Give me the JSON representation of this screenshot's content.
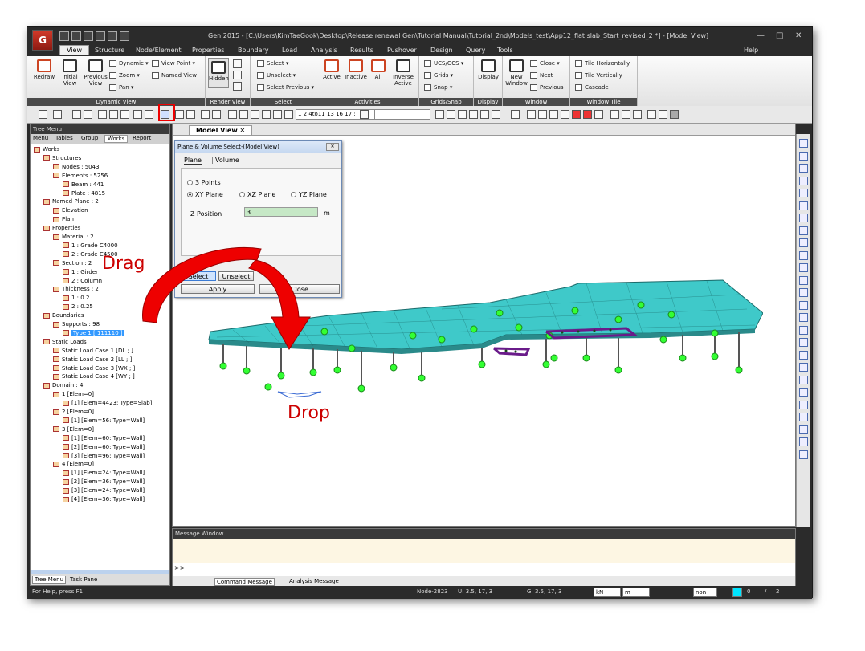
{
  "window": {
    "title": "Gen 2015 - [C:\\Users\\KimTaeGook\\Desktop\\Release renewal Gen\\Tutorial Manual\\Tutorial_2nd\\Models_test\\App12_flat slab_Start_revised_2 *] - [Model View]",
    "logo": "G",
    "help": "Help"
  },
  "menu": {
    "tabs": [
      "View",
      "Structure",
      "Node/Element",
      "Properties",
      "Boundary",
      "Load",
      "Analysis",
      "Results",
      "Pushover",
      "Design",
      "Query",
      "Tools"
    ]
  },
  "ribbon": {
    "dynamic_view": {
      "label": "Dynamic View",
      "redraw": "Redraw",
      "initial": "Initial View",
      "previous": "Previous View",
      "dynamic": "Dynamic",
      "zoom": "Zoom",
      "pan": "Pan",
      "view_point": "View Point",
      "named_view": "Named View"
    },
    "render_view": {
      "label": "Render View",
      "hidden": "Hidden"
    },
    "select": {
      "label": "Select",
      "select": "Select",
      "unselect": "Unselect",
      "select_previous": "Select Previous"
    },
    "activities": {
      "label": "Activities",
      "active": "Active",
      "inactive": "Inactive",
      "all": "All",
      "inverse_active": "Inverse Active"
    },
    "grids_snap": {
      "label": "Grids/Snap",
      "ucs": "UCS/GCS",
      "grids": "Grids",
      "snap": "Snap"
    },
    "display": {
      "label": "Display",
      "display": "Display"
    },
    "window": {
      "label": "Window",
      "new_window": "New Window",
      "close": "Close",
      "next": "Next",
      "previous": "Previous"
    },
    "window_tile": {
      "label": "Window Tile",
      "horizontal": "Tile Horizontally",
      "vertical": "Tile Vertically",
      "cascade": "Cascade"
    }
  },
  "toolbar": {
    "combo": "1 2 4to11 13 16 17 :"
  },
  "tree": {
    "header": "Tree Menu",
    "tabs": [
      "Menu",
      "Tables",
      "Group",
      "Works",
      "Report"
    ],
    "nodes": [
      "Works",
      "Structures",
      "Nodes : 5043",
      "Elements : 5256",
      "Beam : 441",
      "Plate : 4815",
      "Named Plane : 2",
      "Elevation",
      "Plan",
      "Properties",
      "Material : 2",
      "1 : Grade C4000",
      "2 : Grade C4500",
      "Section : 2",
      "1 : Girder",
      "2 : Column",
      "Thickness : 2",
      "1 : 0.2",
      "2 : 0.25",
      "Boundaries",
      "Supports : 98",
      "Type 1 [ 111110 ]",
      "Static Loads",
      "Static Load Case 1 [DL ; ]",
      "Static Load Case 2 [LL ; ]",
      "Static Load Case 3 [WX ; ]",
      "Static Load Case 4 [WY ; ]",
      "Domain : 4",
      "1 [Elem=0]",
      "[1] [Elem=4423: Type=Slab]",
      "2 [Elem=0]",
      "[1] [Elem=56: Type=Wall]",
      "3 [Elem=0]",
      "[1] [Elem=60: Type=Wall]",
      "[2] [Elem=60: Type=Wall]",
      "[3] [Elem=96: Type=Wall]",
      "4 [Elem=0]",
      "[1] [Elem=24: Type=Wall]",
      "[2] [Elem=36: Type=Wall]",
      "[3] [Elem=24: Type=Wall]",
      "[4] [Elem=36: Type=Wall]"
    ],
    "bottom_tabs": [
      "Tree Menu",
      "Task Pane"
    ]
  },
  "view": {
    "tab": "Model View"
  },
  "dialog": {
    "title": "Plane & Volume Select-(Model View)",
    "tabs": [
      "Plane",
      "Volume"
    ],
    "options": [
      "3 Points",
      "XY Plane",
      "XZ Plane",
      "YZ Plane"
    ],
    "z_label": "Z Position",
    "z_value": "3",
    "z_unit": "m",
    "select": "Select",
    "unselect": "Unselect",
    "apply": "Apply",
    "close": "Close"
  },
  "annotations": {
    "drag": "Drag",
    "drop": "Drop"
  },
  "message": {
    "header": "Message Window",
    "prompt": ">>",
    "tabs": [
      "Command Message",
      "Analysis Message"
    ]
  },
  "status": {
    "help": "For Help, press F1",
    "node": "Node-2823",
    "u": "U: 3.5, 17, 3",
    "g": "G: 3.5, 17, 3",
    "force": "kN",
    "length": "m",
    "mode": "non",
    "count": "0",
    "sep": "/",
    "total": "2"
  },
  "colors": {
    "slab": "#3fc9c9",
    "support": "#33ff33",
    "highlight": "#ee0000",
    "wall": "#6a1b8a"
  }
}
